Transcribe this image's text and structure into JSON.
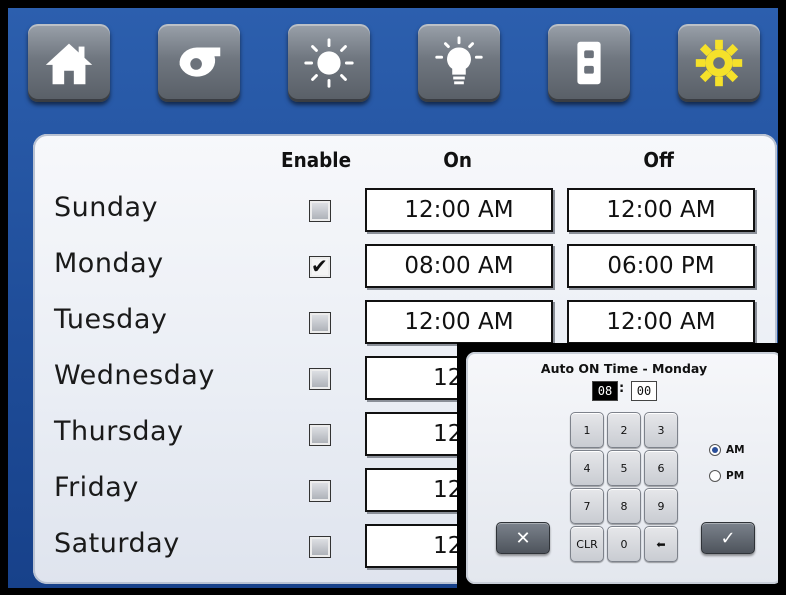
{
  "nav": [
    {
      "id": "home",
      "icon": "home-icon"
    },
    {
      "id": "fan",
      "icon": "fan-icon"
    },
    {
      "id": "sun",
      "icon": "sun-icon"
    },
    {
      "id": "light",
      "icon": "lightbulb-icon"
    },
    {
      "id": "outlet",
      "icon": "outlet-icon"
    },
    {
      "id": "settings",
      "icon": "gear-icon",
      "active_color": "#f5e12a"
    }
  ],
  "schedule": {
    "headers": {
      "enable": "Enable",
      "on": "On",
      "off": "Off"
    },
    "days": [
      {
        "name": "Sunday",
        "enabled": false,
        "on": "12:00 AM",
        "off": "12:00 AM"
      },
      {
        "name": "Monday",
        "enabled": true,
        "on": "08:00 AM",
        "off": "06:00 PM"
      },
      {
        "name": "Tuesday",
        "enabled": false,
        "on": "12:00 AM",
        "off": "12:00 AM"
      },
      {
        "name": "Wednesday",
        "enabled": false,
        "on": "12:0",
        "off": ""
      },
      {
        "name": "Thursday",
        "enabled": false,
        "on": "12:0",
        "off": ""
      },
      {
        "name": "Friday",
        "enabled": false,
        "on": "12:0",
        "off": ""
      },
      {
        "name": "Saturday",
        "enabled": false,
        "on": "12:0",
        "off": ""
      }
    ]
  },
  "popup": {
    "title": "Auto ON Time - Monday",
    "hours": "08",
    "separator": ":",
    "minutes": "00",
    "keys": [
      "1",
      "2",
      "3",
      "4",
      "5",
      "6",
      "7",
      "8",
      "9",
      "CLR",
      "0",
      "⬅"
    ],
    "am_label": "AM",
    "pm_label": "PM",
    "selected": "AM",
    "cancel_label": "✕",
    "confirm_label": "✓"
  },
  "colors": {
    "accent": "#1f4d99",
    "gear": "#f5e12a",
    "panel": "#eef1f6"
  }
}
